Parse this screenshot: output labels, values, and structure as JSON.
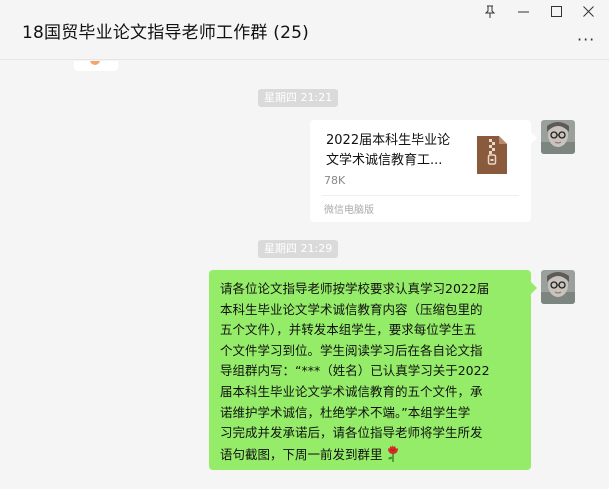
{
  "window": {
    "title": "18国贸毕业论文指导老师工作群 (25)",
    "controls": {
      "pin": "pin-icon",
      "minimize": "minimize-icon",
      "maximize": "maximize-icon",
      "close": "close-icon",
      "more": "more-icon"
    }
  },
  "messages": [
    {
      "time": "星期四 21:21",
      "type": "file",
      "file_name_lines": [
        "2022届本科生毕业论",
        "文学术诚信教育工..."
      ],
      "file_size": "78K",
      "source": "微信电脑版",
      "icon": "zip-file-icon",
      "icon_color": "#8a5a3c"
    },
    {
      "time": "星期四 21:29",
      "type": "text",
      "lines": [
        "请各位论文指导老师按学校要求认真学习2022届",
        "本科生毕业论文学术诚信教育内容（压缩包里的",
        "五个文件），并转发本组学生，要求每位学生五",
        "个文件学习到位。学生阅读学习后在各自论文指",
        "导组群内写：“***（姓名）已认真学习关于2022",
        "届本科生毕业论文学术诚信教育的五个文件，承",
        "诺维护学术诚信，杜绝学术不端。”本组学生学",
        "习完成并发承诺后，请各位指导老师将学生所发",
        "语句截图，下周一前发到群里"
      ],
      "emoji": "rose-icon",
      "bubble_color": "#95ec69"
    }
  ]
}
